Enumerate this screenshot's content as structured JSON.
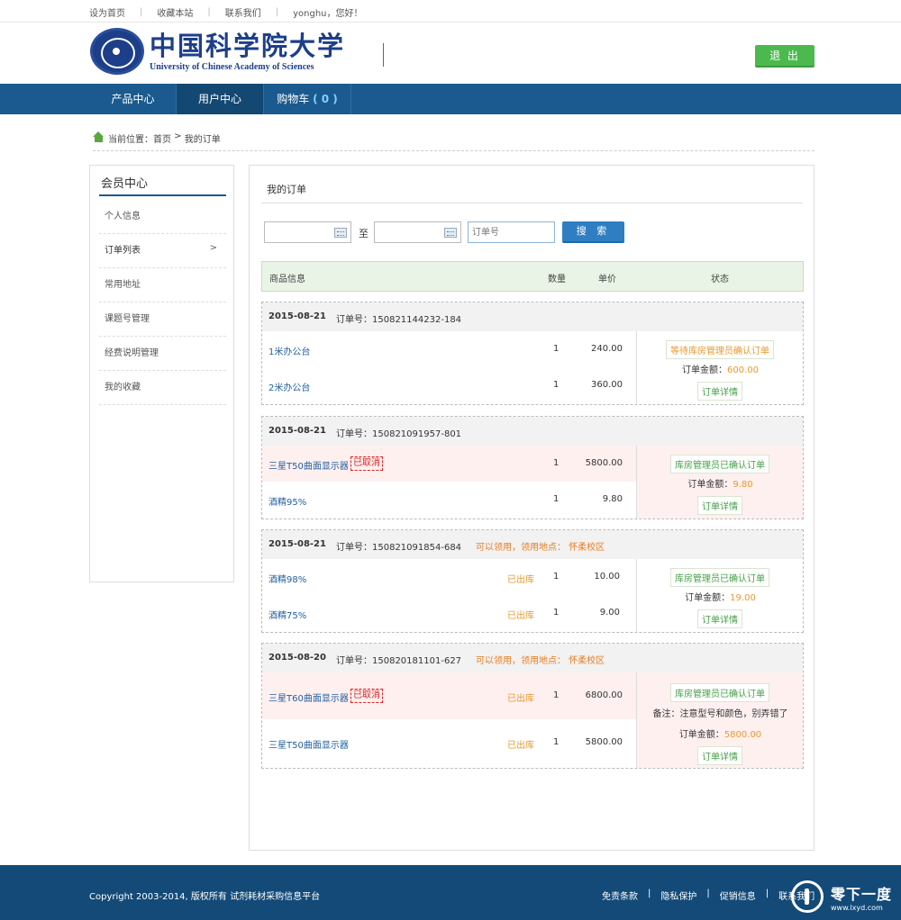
{
  "topbar": {
    "set_home": "设为首页",
    "bookmark": "收藏本站",
    "contact": "联系我们",
    "greeting": "yonghu，您好！"
  },
  "header": {
    "logo_cn": "中国科学院大学",
    "logo_en": "University of Chinese Academy of Sciences",
    "logout": "退 出"
  },
  "nav": {
    "products": "产品中心",
    "user_center": "用户中心",
    "cart": "购物车",
    "cart_count": "( 0 )"
  },
  "breadcrumb": {
    "prefix": "当前位置：",
    "home": "首页",
    "sep": " > ",
    "current": "我的订单"
  },
  "sidebar": {
    "title": "会员中心",
    "items": [
      {
        "label": "个人信息"
      },
      {
        "label": "订单列表",
        "arrow": ">"
      },
      {
        "label": "常用地址"
      },
      {
        "label": "课题号管理"
      },
      {
        "label": "经费说明管理"
      },
      {
        "label": "我的收藏"
      }
    ]
  },
  "main": {
    "title": "我的订单",
    "to_label": "至",
    "order_placeholder": "订单号",
    "search": "搜 索",
    "columns": {
      "product": "商品信息",
      "qty": "数量",
      "price": "单价",
      "status": "状态"
    }
  },
  "orders": [
    {
      "date": "2015-08-21",
      "order_no": "订单号：150821144232-184",
      "pickup": "",
      "items": [
        {
          "name": "1米办公台",
          "cancelled": "",
          "outbound": "",
          "qty": "1",
          "price": "240.00"
        },
        {
          "name": "2米办公台",
          "cancelled": "",
          "outbound": "",
          "qty": "1",
          "price": "360.00"
        }
      ],
      "status": "等待库房管理员确认订单",
      "note": "",
      "amount_label": "订单金额：",
      "amount": "600.00",
      "detail": "订单详情"
    },
    {
      "date": "2015-08-21",
      "order_no": "订单号：150821091957-801",
      "pickup": "",
      "items": [
        {
          "name": "三星T50曲面显示器",
          "cancelled": "已取消",
          "outbound": "",
          "qty": "1",
          "price": "5800.00"
        },
        {
          "name": "酒精95%",
          "cancelled": "",
          "outbound": "",
          "qty": "1",
          "price": "9.80"
        }
      ],
      "status": "库房管理员已确认订单",
      "note": "",
      "amount_label": "订单金额：",
      "amount": "9.80",
      "detail": "订单详情"
    },
    {
      "date": "2015-08-21",
      "order_no": "订单号：150821091854-684",
      "pickup": "可以领用，领用地点：  怀柔校区",
      "items": [
        {
          "name": "酒精98%",
          "cancelled": "",
          "outbound": "已出库",
          "qty": "1",
          "price": "10.00"
        },
        {
          "name": "酒精75%",
          "cancelled": "",
          "outbound": "已出库",
          "qty": "1",
          "price": "9.00"
        }
      ],
      "status": "库房管理员已确认订单",
      "note": "",
      "amount_label": "订单金额：",
      "amount": "19.00",
      "detail": "订单详情"
    },
    {
      "date": "2015-08-20",
      "order_no": "订单号：150820181101-627",
      "pickup": "可以领用，领用地点：  怀柔校区",
      "items": [
        {
          "name": "三星T60曲面显示器",
          "cancelled": "已取消",
          "outbound": "已出库",
          "qty": "1",
          "price": "6800.00"
        },
        {
          "name": "三星T50曲面显示器",
          "cancelled": "",
          "outbound": "已出库",
          "qty": "1",
          "price": "5800.00"
        }
      ],
      "status": "库房管理员已确认订单",
      "note": "备注：注意型号和颜色，别弄错了",
      "amount_label": "订单金额：",
      "amount": "5800.00",
      "detail": "订单详情"
    }
  ],
  "footer": {
    "copyright": "Copyright 2003-2014, 版权所有 试剂耗材采购信息平台",
    "links": [
      "免责条款",
      "隐私保护",
      "促销信息",
      "联系我们"
    ]
  },
  "watermark": {
    "cn": "零下一度",
    "en": "www.lxyd.com"
  }
}
